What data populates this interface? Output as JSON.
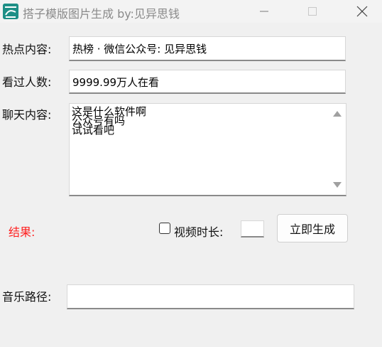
{
  "window": {
    "title": "搭子模版图片生成 by:见异思钱",
    "min_label": "—",
    "max_label": "☐",
    "close_label": "✕"
  },
  "form": {
    "hot_label": "热点内容:",
    "hot_value": "热榜 · 微信公众号: 见异思钱",
    "viewers_label": "看过人数:",
    "viewers_value": "9999.99万人在看",
    "chat_label": "聊天内容:",
    "chat_lines": [
      "这是什么软件啊",
      "公众号有吗",
      "试试看吧"
    ],
    "result_label": "结果:",
    "video_duration_label": "视频时长:",
    "video_duration_value": "",
    "generate_button": "立即生成",
    "music_label": "音乐路径:",
    "music_value": ""
  },
  "colors": {
    "result": "#ff2020",
    "icon": "#1e8f86"
  },
  "icons": {
    "app": "app-logo-icon",
    "scroll_up": "scroll-up-arrow-icon",
    "scroll_down": "scroll-down-arrow-icon"
  }
}
